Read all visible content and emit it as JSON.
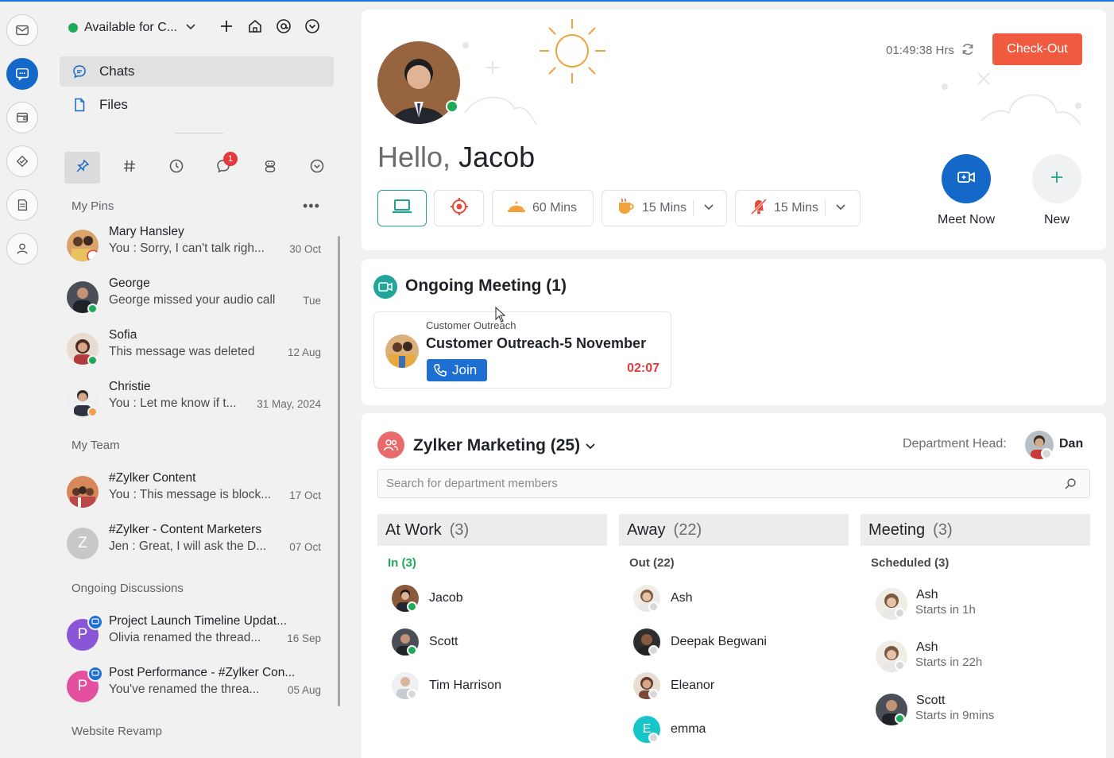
{
  "status": {
    "label": "Available for C...",
    "color": "#1eaa58"
  },
  "nav": {
    "chats": "Chats",
    "files": "Files"
  },
  "filters": {
    "unread_badge": "1"
  },
  "pins": {
    "title": "My Pins",
    "items": [
      {
        "name": "Mary Hansley",
        "msg": "You : Sorry, I can't talk righ...",
        "time": "30 Oct"
      },
      {
        "name": "George",
        "msg": "George missed your audio call",
        "time": "Tue"
      },
      {
        "name": "Sofia",
        "msg": "This message was deleted",
        "time": "12 Aug"
      },
      {
        "name": "Christie",
        "msg": "You : Let me know if t...",
        "time": "31 May, 2024"
      }
    ]
  },
  "team": {
    "title": "My Team",
    "items": [
      {
        "name": "#Zylker Content",
        "msg": "You : This message is block...",
        "time": "17 Oct"
      },
      {
        "name": "#Zylker - Content Marketers",
        "msg": "Jen : Great, I will ask the D...",
        "time": "07 Oct",
        "initial": "Z"
      }
    ]
  },
  "discussions": {
    "title": "Ongoing Discussions",
    "items": [
      {
        "name": "Project Launch Timeline Updat...",
        "msg": "Olivia renamed the thread...",
        "time": "16 Sep",
        "initial": "P"
      },
      {
        "name": "Post Performance - #Zylker Con...",
        "msg": "You've renamed the threa...",
        "time": "05 Aug",
        "initial": "P"
      }
    ]
  },
  "website": {
    "title": "Website Revamp"
  },
  "greeting": {
    "hello": "Hello,",
    "name": "Jacob"
  },
  "shift": {
    "timer": "01:49:38 Hrs",
    "checkout": "Check-Out"
  },
  "breaks": [
    {
      "label": "60 Mins"
    },
    {
      "label": "15 Mins"
    },
    {
      "label": "15 Mins"
    }
  ],
  "actions": {
    "meet_now": "Meet Now",
    "new": "New"
  },
  "ongoing": {
    "title": "Ongoing Meeting (1)",
    "group": "Customer Outreach",
    "meeting": "Customer Outreach-5 November",
    "join": "Join",
    "elapsed": "02:07"
  },
  "department": {
    "title": "Zylker Marketing (25)",
    "head_label": "Department Head:",
    "head_name": "Dan",
    "search_placeholder": "Search for department members",
    "columns": [
      {
        "title": "At Work",
        "count": "(3)",
        "sub": "In (3)",
        "members": [
          {
            "name": "Jacob"
          },
          {
            "name": "Scott"
          },
          {
            "name": "Tim Harrison"
          }
        ]
      },
      {
        "title": "Away",
        "count": "(22)",
        "sub": "Out (22)",
        "members": [
          {
            "name": "Ash"
          },
          {
            "name": "Deepak Begwani"
          },
          {
            "name": "Eleanor"
          },
          {
            "name": "emma",
            "initial": "E"
          }
        ]
      },
      {
        "title": "Meeting",
        "count": "(3)",
        "sub": "Scheduled (3)",
        "members": [
          {
            "name": "Ash",
            "sub": "Starts in 1h"
          },
          {
            "name": "Ash",
            "sub": "Starts in 22h"
          },
          {
            "name": "Scott",
            "sub": "Starts in 9mins"
          }
        ]
      }
    ]
  },
  "colors": {
    "accent": "#1468c8",
    "checkout": "#ef5a40",
    "online": "#1eaa58",
    "away": "#f0a04b",
    "in": "#1eaa58",
    "error": "#e5393d"
  }
}
